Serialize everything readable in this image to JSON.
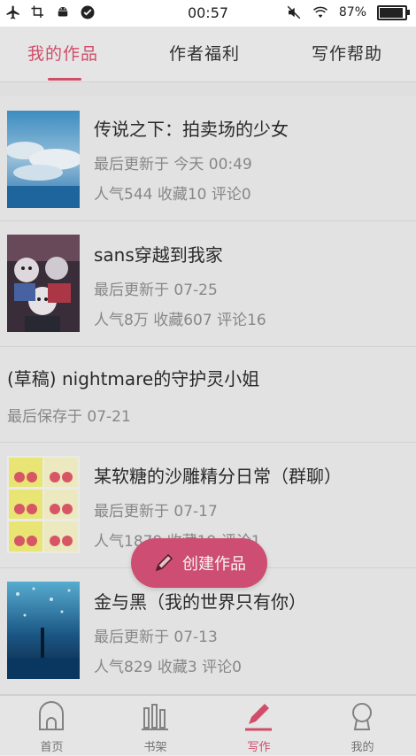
{
  "status_bar": {
    "time": "00:57",
    "battery": "87%",
    "battery_level": 0.87,
    "left_icons": [
      "airplane-icon",
      "crop-icon",
      "android-icon",
      "check-circle-icon"
    ],
    "right_icons": [
      "mute-icon",
      "wifi-icon"
    ]
  },
  "tabs": [
    {
      "label": "我的作品",
      "active": true
    },
    {
      "label": "作者福利",
      "active": false
    },
    {
      "label": "写作帮助",
      "active": false
    }
  ],
  "works": [
    {
      "title": "传说之下：拍卖场的少女",
      "updated": "最后更新于 今天 00:49",
      "stats": "人气544  收藏10  评论0",
      "cover": "blue-sky"
    },
    {
      "title": "sans穿越到我家",
      "updated": "最后更新于 07-25",
      "stats": "人气8万  收藏607  评论16",
      "cover": "anime"
    },
    {
      "title": "(草稿) nightmare的守护灵小姐",
      "updated": "最后保存于 07-21",
      "stats": "",
      "cover": ""
    },
    {
      "title": "某软糖的沙雕精分日常（群聊）",
      "updated": "最后更新于 07-17",
      "stats": "人气1879  收藏19  评论1",
      "cover": "meme"
    },
    {
      "title": "金与黑（我的世界只有你）",
      "updated": "最后更新于 07-13",
      "stats": "人气829  收藏3  评论0",
      "cover": "night-sea"
    }
  ],
  "fab": {
    "label": "创建作品",
    "icon": "pencil-icon"
  },
  "bottom_nav": [
    {
      "label": "首页",
      "icon": "home-icon",
      "active": false
    },
    {
      "label": "书架",
      "icon": "bookshelf-icon",
      "active": false
    },
    {
      "label": "写作",
      "icon": "pen-icon",
      "active": true
    },
    {
      "label": "我的",
      "icon": "profile-icon",
      "active": false
    }
  ],
  "colors": {
    "accent": "#d9506e",
    "fab": "#d65277"
  }
}
